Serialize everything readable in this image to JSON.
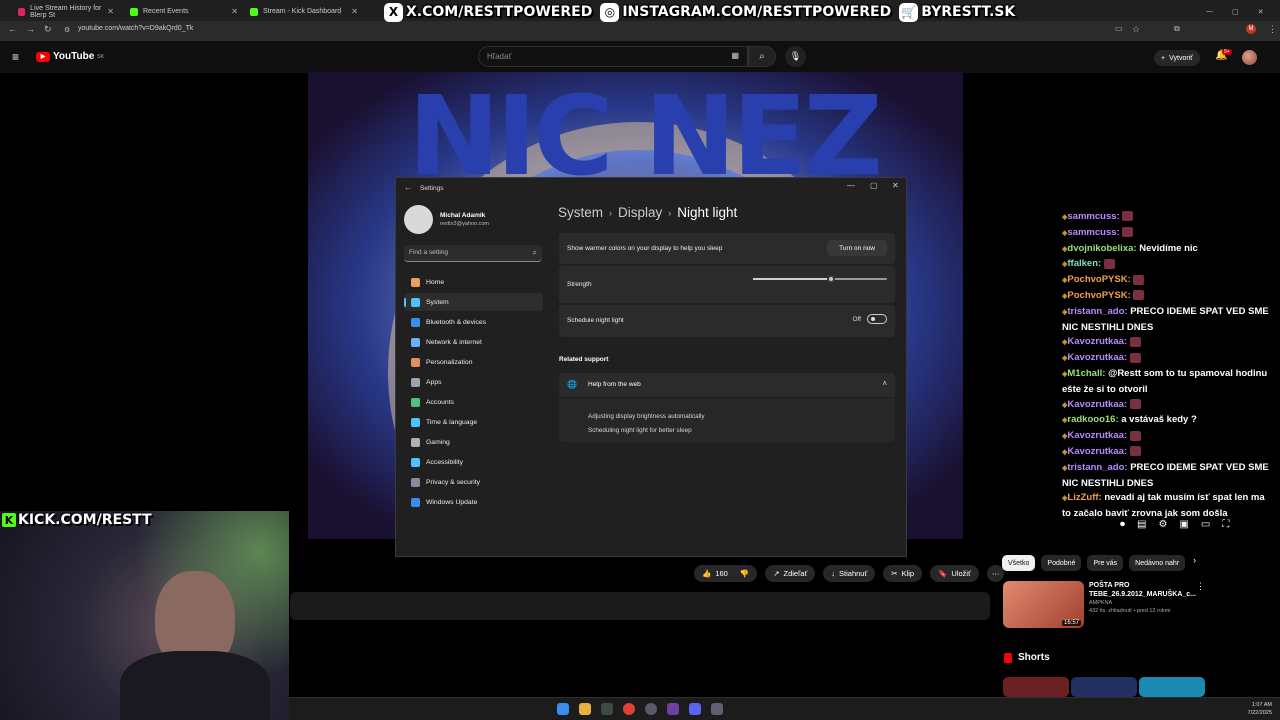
{
  "browser": {
    "tabs": [
      {
        "label": "Live Stream History for Blerp St"
      },
      {
        "label": "Recent Events"
      },
      {
        "label": "Stream - Kick Dashboard"
      }
    ],
    "url": "youtube.com/watch?v=D9akQrd0_Tk"
  },
  "overlay": {
    "x_handle": "X.COM/RESTTPOWERED",
    "instagram_handle": "INSTAGRAM.COM/RESTTPOWERED",
    "shop": "BYRESTT.SK",
    "kick_handle": "KICK.COM/RESTT"
  },
  "youtube": {
    "logo": "YouTube",
    "region": "SK",
    "search_placeholder": "Hľadať",
    "create_label": "Vytvoriť",
    "notif_count": "9+",
    "video_text": "NIC NEZ",
    "actions": {
      "likes": "160",
      "share": "Zdieľať",
      "download": "Stiahnuť",
      "clip": "Klip",
      "save": "Uložiť"
    },
    "chips": [
      "Všetko",
      "Podobné",
      "Pre vás",
      "Nedávno nahr"
    ],
    "recommendation": {
      "title": "POŠTA PRO TEBE_26.9.2012_MARUŠKA_c...",
      "channel": "AMPKNA",
      "meta": "432 tis. zhliadnutí • pred 12 rokmi",
      "duration": "16:57"
    },
    "shorts_label": "Shorts"
  },
  "chat": [
    {
      "user": "sammcuss",
      "text": "",
      "color": "purple"
    },
    {
      "user": "sammcuss",
      "text": "",
      "color": "purple"
    },
    {
      "user": "dvojnikobelixa",
      "text": "Nevidíme nic",
      "color": "green"
    },
    {
      "user": "ffalken",
      "text": "",
      "color": "teal"
    },
    {
      "user": "PochvoPYSK",
      "text": "",
      "color": "orange"
    },
    {
      "user": "PochvoPYSK",
      "text": "",
      "color": "orange"
    },
    {
      "user": "tristann_ado",
      "text": "PRECO IDEME SPAT VED SME NIC NESTIHLI DNES",
      "color": "purple"
    },
    {
      "user": "Kavozrutkaa",
      "text": "",
      "color": "purple"
    },
    {
      "user": "Kavozrutkaa",
      "text": "",
      "color": "purple"
    },
    {
      "user": "M1chall",
      "text": "@Restt som to tu spamoval hodinu ešte že si to otvoril",
      "color": "green"
    },
    {
      "user": "Kavozrutkaa",
      "text": "",
      "color": "purple"
    },
    {
      "user": "radkooo16",
      "text": "a vstávaš kedy ?",
      "color": "green"
    },
    {
      "user": "Kavozrutkaa",
      "text": "",
      "color": "purple"
    },
    {
      "user": "Kavozrutkaa",
      "text": "",
      "color": "purple"
    },
    {
      "user": "tristann_ado",
      "text": "PRECO IDEME SPAT VED SME NIC NESTIHLI DNES",
      "color": "purple"
    },
    {
      "user": "LizZuff",
      "text": "nevadí aj tak musím ísť spat len ma to začalo baviť zrovna jak som došla",
      "color": "orange"
    }
  ],
  "settings": {
    "window_title": "Settings",
    "user_name": "Michal Adamik",
    "user_email": "resttx3@yahoo.com",
    "search_placeholder": "Find a setting",
    "nav": [
      {
        "label": "Home",
        "icon": "home-icon",
        "color": "#e8a060"
      },
      {
        "label": "System",
        "icon": "system-icon",
        "color": "#4cc2ff",
        "active": true
      },
      {
        "label": "Bluetooth & devices",
        "icon": "bluetooth-icon",
        "color": "#3a8ef0"
      },
      {
        "label": "Network & internet",
        "icon": "wifi-icon",
        "color": "#6ab0ff"
      },
      {
        "label": "Personalization",
        "icon": "brush-icon",
        "color": "#e09060"
      },
      {
        "label": "Apps",
        "icon": "apps-icon",
        "color": "#a0a0b0"
      },
      {
        "label": "Accounts",
        "icon": "accounts-icon",
        "color": "#50c080"
      },
      {
        "label": "Time & language",
        "icon": "globe-clock-icon",
        "color": "#4cc2ff"
      },
      {
        "label": "Gaming",
        "icon": "gamepad-icon",
        "color": "#b0b0b0"
      },
      {
        "label": "Accessibility",
        "icon": "accessibility-icon",
        "color": "#4cc2ff"
      },
      {
        "label": "Privacy & security",
        "icon": "shield-icon",
        "color": "#8a8a9a"
      },
      {
        "label": "Windows Update",
        "icon": "update-icon",
        "color": "#3a8ef0"
      }
    ],
    "breadcrumb": [
      "System",
      "Display",
      "Night light"
    ],
    "warmer_text": "Show warmer colors on your display to help you sleep",
    "turn_on_label": "Turn on now",
    "strength_label": "Strength",
    "strength_value": 0.58,
    "schedule_label": "Schedule night light",
    "schedule_state": "Off",
    "related_support": "Related support",
    "help_title": "Help from the web",
    "help_links": [
      "Adjusting display brightness automatically",
      "Scheduling night light for better sleep"
    ]
  },
  "taskbar": {
    "time": "1:07 AM",
    "date": "7/22/2025"
  }
}
